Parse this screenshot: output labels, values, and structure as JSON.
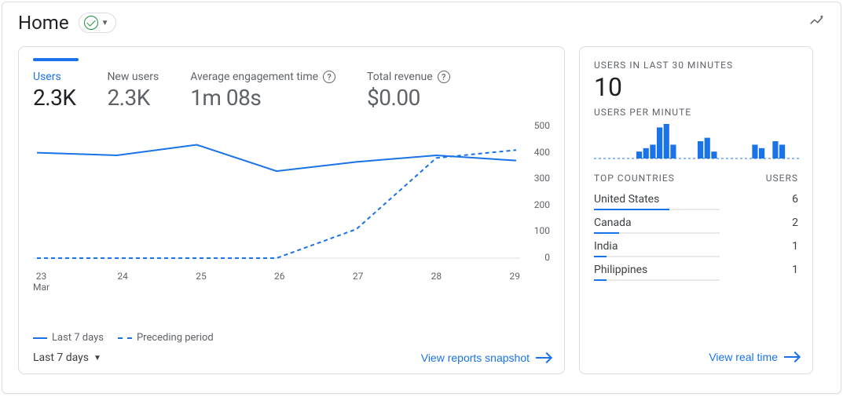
{
  "header": {
    "title": "Home"
  },
  "main_card": {
    "metrics": [
      {
        "label": "Users",
        "value": "2.3K",
        "active": true,
        "help": false
      },
      {
        "label": "New users",
        "value": "2.3K",
        "active": false,
        "help": false
      },
      {
        "label": "Average engagement time",
        "value": "1m 08s",
        "active": false,
        "help": true
      },
      {
        "label": "Total revenue",
        "value": "$0.00",
        "active": false,
        "help": true
      }
    ],
    "legend": {
      "current": "Last 7 days",
      "previous": "Preceding period"
    },
    "range_label": "Last 7 days",
    "footer_link": "View reports snapshot"
  },
  "chart_data": {
    "type": "line",
    "categories": [
      "23 Mar",
      "24",
      "25",
      "26",
      "27",
      "28",
      "29"
    ],
    "series": [
      {
        "name": "Last 7 days",
        "values": [
          400,
          390,
          430,
          330,
          365,
          390,
          370
        ]
      },
      {
        "name": "Preceding period",
        "values": [
          0,
          0,
          0,
          0,
          110,
          380,
          410
        ]
      }
    ],
    "ylim": [
      0,
      500
    ],
    "yticks": [
      0,
      100,
      200,
      300,
      400,
      500
    ],
    "xlabel": "",
    "ylabel": ""
  },
  "side_card": {
    "users_label": "USERS IN LAST 30 MINUTES",
    "users_value": "10",
    "per_minute_label": "USERS PER MINUTE",
    "per_minute_values": [
      0,
      0,
      0,
      0,
      0,
      0,
      2,
      3,
      4,
      9,
      10,
      4,
      0,
      0,
      0,
      5,
      6,
      2,
      0,
      0,
      0,
      0,
      0,
      4,
      3,
      0,
      5,
      4,
      0,
      0
    ],
    "countries_header": {
      "left": "TOP COUNTRIES",
      "right": "USERS"
    },
    "countries": [
      {
        "name": "United States",
        "users": 6
      },
      {
        "name": "Canada",
        "users": 2
      },
      {
        "name": "India",
        "users": 1
      },
      {
        "name": "Philippines",
        "users": 1
      }
    ],
    "footer_link": "View real time"
  }
}
